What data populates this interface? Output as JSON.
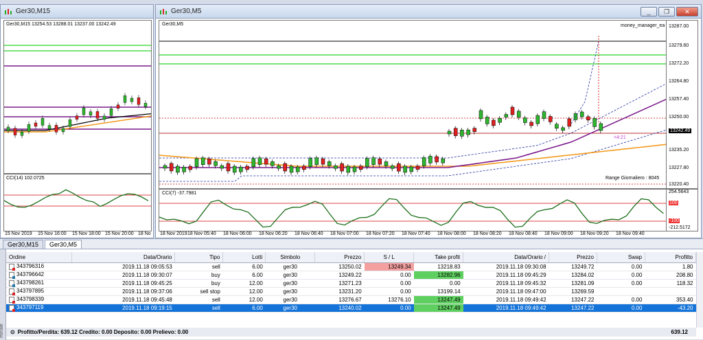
{
  "windows": {
    "left": {
      "title": "Ger30,M15",
      "info": "Ger30,M15  13254.53 13288.01 13237.00 13242.49",
      "cci_label": "CCI(14) 102.0725",
      "time_labels": [
        "15 Nov 2019",
        "15 Nov 16:00",
        "15 Nov 18:00",
        "15 Nov 20:00",
        "18 No"
      ]
    },
    "main": {
      "title": "Ger30,M5",
      "info": "Ger30,M5",
      "ea_label": "money_manager_ea",
      "cci_label": "CCI(7) -37.7981",
      "range_label": "Range Giornaliero :  8045",
      "countdown": "<4:21",
      "price_labels": [
        "13287.00",
        "13279.60",
        "13272.20",
        "13264.80",
        "13257.40",
        "13250.00",
        "13242.49",
        "13235.20",
        "13227.80",
        "13220.40"
      ],
      "cci_scale": [
        "254.5643",
        "100",
        "-100",
        "-212.5172"
      ],
      "time_labels": [
        "18 Nov 2019",
        "18 Nov 05:40",
        "18 Nov 06:00",
        "18 Nov 06:20",
        "18 Nov 06:40",
        "18 Nov 07:00",
        "18 Nov 07:20",
        "18 Nov 07:40",
        "18 Nov 08:00",
        "18 Nov 08:20",
        "18 Nov 08:40",
        "18 Nov 09:00",
        "18 Nov 09:20",
        "18 Nov 09:40"
      ],
      "btn_min": "_",
      "btn_max": "❐",
      "btn_close": "✕"
    }
  },
  "tabs": [
    "Ger30,M15",
    "Ger30,M5"
  ],
  "terminal": {
    "side_label": "minale",
    "columns": [
      "Ordine",
      "Data/Orario",
      "Tipo",
      "Lotti",
      "Simbolo",
      "Prezzo",
      "S / L",
      "Take profit",
      "Data/Orario  /",
      "Prezzo",
      "Swap",
      "Profitto"
    ],
    "rows": [
      {
        "order": "343796316",
        "time": "2019.11.18 09:05:53",
        "type": "sell",
        "lots": "6.00",
        "symbol": "ger30",
        "price": "13250.02",
        "sl": "13249.34",
        "tp": "13218.83",
        "ctime": "2019.11.18 09:30:08",
        "cprice": "13249.72",
        "swap": "0.00",
        "profit": "1.80"
      },
      {
        "order": "343796642",
        "time": "2019.11.18 09:30:07",
        "type": "buy",
        "lots": "6.00",
        "symbol": "ger30",
        "price": "13249.22",
        "sl": "0.00",
        "tp": "13282.96",
        "ctime": "2019.11.18 09:45:29",
        "cprice": "13284.02",
        "swap": "0.00",
        "profit": "208.80"
      },
      {
        "order": "343798261",
        "time": "2019.11.18 09:45:25",
        "type": "buy",
        "lots": "12.00",
        "symbol": "ger30",
        "price": "13271.23",
        "sl": "0.00",
        "tp": "0.00",
        "ctime": "2019.11.18 09:45:32",
        "cprice": "13281.09",
        "swap": "0.00",
        "profit": "118.32"
      },
      {
        "order": "343797895",
        "time": "2019.11.18 09:37:06",
        "type": "sell stop",
        "lots": "12.00",
        "symbol": "ger30",
        "price": "13231.20",
        "sl": "0.00",
        "tp": "13199.14",
        "ctime": "2019.11.18 09:47:00",
        "cprice": "13269.59",
        "swap": "",
        "profit": ""
      },
      {
        "order": "343798339",
        "time": "2019.11.18 09:45:48",
        "type": "sell",
        "lots": "12.00",
        "symbol": "ger30",
        "price": "13276.67",
        "sl": "13276.10",
        "tp": "13247.49",
        "ctime": "2019.11.18 09:49:42",
        "cprice": "13247.22",
        "swap": "0.00",
        "profit": "353.40"
      },
      {
        "order": "343797119",
        "time": "2019.11.18 09:19:15",
        "type": "sell",
        "lots": "6.00",
        "symbol": "ger30",
        "price": "13240.02",
        "sl": "0.00",
        "tp": "13247.49",
        "ctime": "2019.11.18 09:49:42",
        "cprice": "13247.22",
        "swap": "0.00",
        "profit": "-43.20"
      }
    ],
    "footer": "Profitto/Perdita: 639.12  Credito: 0.00  Deposito: 0.00  Prelievo: 0.00",
    "footer_total": "639.12"
  },
  "colors": {
    "bull": "#2fb62f",
    "bear": "#e02020",
    "ma_purple": "#7b1a8c",
    "ma_orange": "#f39a1e",
    "band": "#1e2f9e",
    "cci": "#1a6e1a"
  }
}
